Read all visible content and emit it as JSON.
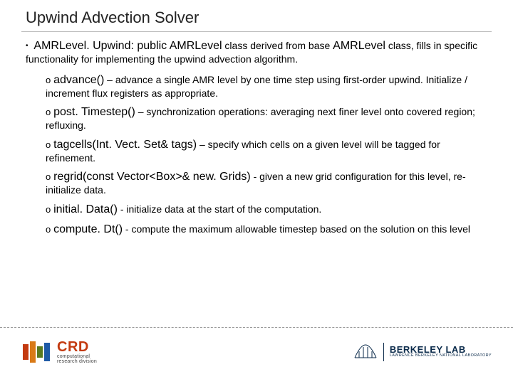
{
  "title": "Upwind Advection Solver",
  "lead": {
    "bullet": "•",
    "class_name": "AMRLevel. Upwind: public AMRLevel",
    "mid": " class derived from base ",
    "base": "AMRLevel",
    "tail": " class, fills in specific functionality for implementing the upwind advection algorithm."
  },
  "items": [
    {
      "o": "o",
      "fn": "advance()",
      "desc": " – advance a single AMR level by one time step using first-order upwind. Initialize / increment flux registers as appropriate."
    },
    {
      "o": "o",
      "fn": "post. Timestep()",
      "desc": " – synchronization operations: averaging next finer level onto covered region; refluxing."
    },
    {
      "o": "o",
      "fn": "tagcells(Int. Vect. Set& tags)",
      "desc": " – specify which cells on a given level will be tagged for refinement."
    },
    {
      "o": "o",
      "fn": "regrid(const Vector<Box>& new. Grids)",
      "desc": " - given a new grid configuration for this level, re-initialize data."
    },
    {
      "o": "o",
      "fn": "initial. Data()",
      "desc": "  - initialize data at the start of the computation."
    },
    {
      "o": "o",
      "fn": "compute. Dt()",
      "desc": " - compute the maximum allowable timestep based on the solution on this level"
    }
  ],
  "footer": {
    "crd": {
      "big": "CRD",
      "l1": "computational",
      "l2": "research division"
    },
    "lbl": {
      "big": "BERKELEY LAB",
      "small": "LAWRENCE BERKELEY NATIONAL LABORATORY"
    }
  }
}
